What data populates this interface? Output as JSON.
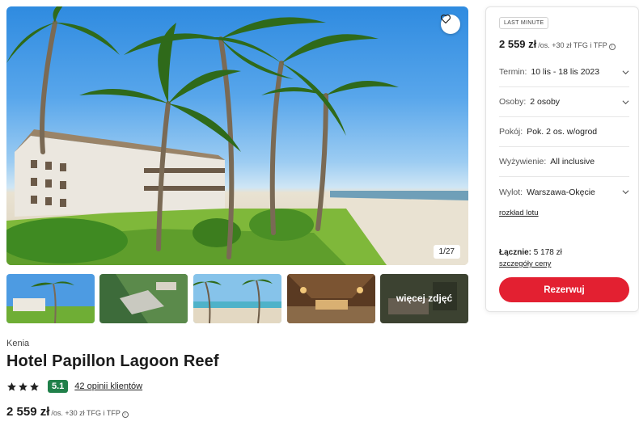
{
  "gallery": {
    "counter": "1/27",
    "more_label": "więcej zdjęć"
  },
  "hotel": {
    "country": "Kenia",
    "name": "Hotel Papillon Lagoon Reef",
    "stars": 3,
    "score": "5.1",
    "reviews_label": "42 opinii klientów",
    "price": "2 559 zł",
    "price_suffix": "/os. +30 zł TFG i TFP"
  },
  "panel": {
    "badge": "LAST MINUTE",
    "price": "2 559 zł",
    "price_suffix": "/os. +30 zł TFG i TFP",
    "fields": [
      {
        "label": "Termin:",
        "value": "10 lis - 18 lis 2023"
      },
      {
        "label": "Osoby:",
        "value": "2 osoby"
      },
      {
        "label": "Pokój:",
        "value": "Pok. 2 os. w/ogrod"
      },
      {
        "label": "Wyżywienie:",
        "value": "All inclusive"
      },
      {
        "label": "Wylot:",
        "value": "Warszawa-Okęcie"
      }
    ],
    "flight_link": "rozkład lotu",
    "total_label": "Łącznie:",
    "total_value": "5 178 zł",
    "price_details_link": "szczegóły ceny",
    "book_button": "Rezerwuj"
  },
  "colors": {
    "accent": "#e32031",
    "score_badge": "#20804a"
  }
}
